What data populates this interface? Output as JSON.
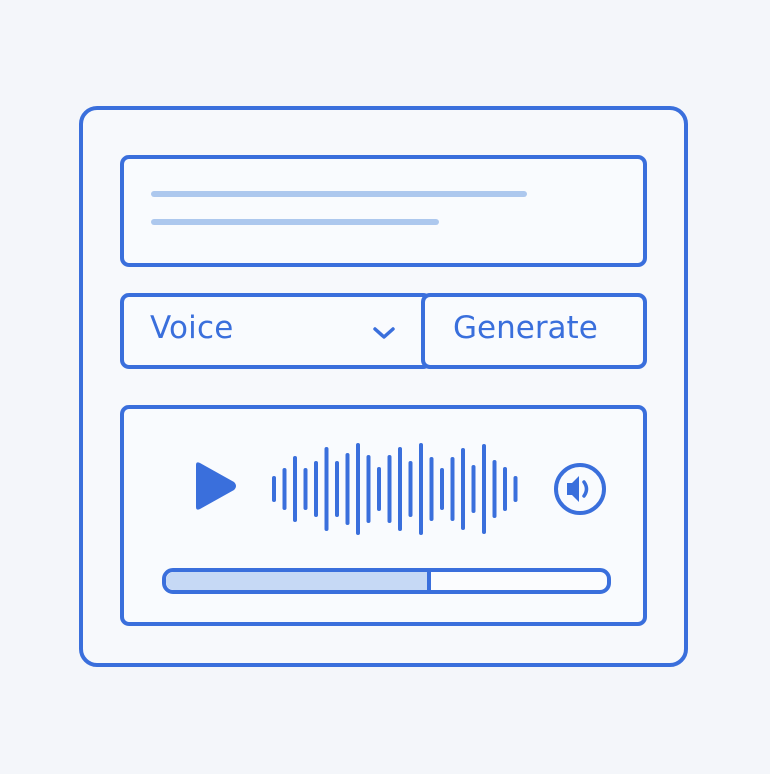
{
  "colors": {
    "accent": "#3a6fdc",
    "placeholder_line": "#adc8ee",
    "progress_fill": "#c6d9f5",
    "background": "#f4f6fa"
  },
  "voice_select": {
    "value": "Voice",
    "icon": "chevron-down-icon"
  },
  "generate_button": {
    "label": "Generate"
  },
  "player": {
    "play_icon": "play-icon",
    "volume_icon": "speaker-icon",
    "progress": 0.6
  }
}
